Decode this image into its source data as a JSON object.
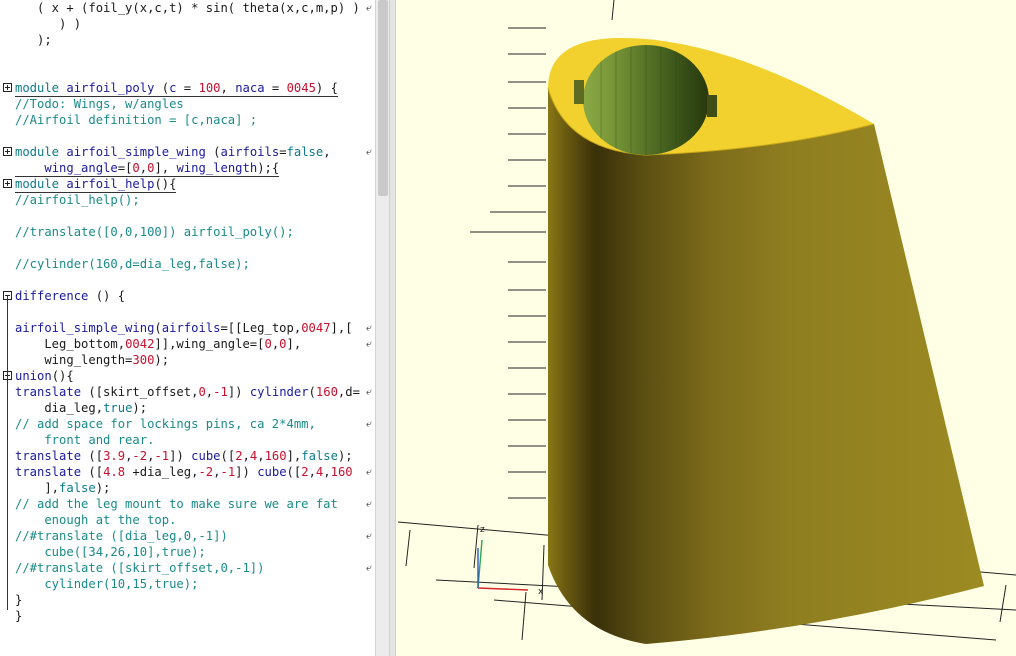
{
  "editor": {
    "lines": [
      {
        "t": 0,
        "gutter": "",
        "wrap": true,
        "tokens": [
          [
            "pl",
            "   ( x + (foil_y(x,c,t) * sin( theta(x,c,m,p) ) "
          ]
        ]
      },
      {
        "t": 16,
        "gutter": "",
        "tokens": [
          [
            "pl",
            "      ) )"
          ]
        ]
      },
      {
        "t": 32,
        "gutter": "",
        "tokens": [
          [
            "pl",
            "   );"
          ]
        ]
      },
      {
        "t": 48,
        "gutter": "",
        "tokens": [
          [
            "pl",
            ""
          ]
        ]
      },
      {
        "t": 64,
        "gutter": "",
        "tokens": [
          [
            "pl",
            ""
          ]
        ]
      },
      {
        "t": 80,
        "gutter": "plus",
        "underline": true,
        "tokens": [
          [
            "kw",
            "module"
          ],
          [
            "pl",
            " "
          ],
          [
            "id",
            "airfoil_poly"
          ],
          [
            "pl",
            " ("
          ],
          [
            "id",
            "c"
          ],
          [
            "pl",
            " = "
          ],
          [
            "num",
            "100"
          ],
          [
            "pl",
            ", "
          ],
          [
            "id",
            "naca"
          ],
          [
            "pl",
            " = "
          ],
          [
            "num",
            "0045"
          ],
          [
            "pl",
            ") {"
          ]
        ]
      },
      {
        "t": 96,
        "gutter": "",
        "tokens": [
          [
            "com",
            "//Todo: Wings, w/angles"
          ]
        ]
      },
      {
        "t": 112,
        "gutter": "",
        "tokens": [
          [
            "com",
            "//Airfoil definition = [c,naca] ;"
          ]
        ]
      },
      {
        "t": 128,
        "gutter": "",
        "tokens": [
          [
            "pl",
            ""
          ]
        ]
      },
      {
        "t": 144,
        "gutter": "plus",
        "wrap": true,
        "tokens": [
          [
            "kw",
            "module"
          ],
          [
            "pl",
            " "
          ],
          [
            "id",
            "airfoil_simple_wing"
          ],
          [
            "pl",
            " ("
          ],
          [
            "id",
            "airfoils"
          ],
          [
            "pl",
            "="
          ],
          [
            "kw",
            "false"
          ],
          [
            "pl",
            ","
          ]
        ]
      },
      {
        "t": 160,
        "gutter": "",
        "underline": true,
        "tokens": [
          [
            "pl",
            "    "
          ],
          [
            "id",
            "wing_angle"
          ],
          [
            "pl",
            "=["
          ],
          [
            "num",
            "0"
          ],
          [
            "pl",
            ","
          ],
          [
            "num",
            "0"
          ],
          [
            "pl",
            "], "
          ],
          [
            "id",
            "wing_length"
          ],
          [
            "pl",
            ");{"
          ]
        ]
      },
      {
        "t": 176,
        "gutter": "plus",
        "underline": true,
        "tokens": [
          [
            "kw",
            "module"
          ],
          [
            "pl",
            " "
          ],
          [
            "id",
            "airfoil_help"
          ],
          [
            "pl",
            "(){"
          ]
        ]
      },
      {
        "t": 192,
        "gutter": "",
        "tokens": [
          [
            "com",
            "//airfoil_help();"
          ]
        ]
      },
      {
        "t": 208,
        "gutter": "",
        "tokens": [
          [
            "pl",
            ""
          ]
        ]
      },
      {
        "t": 224,
        "gutter": "",
        "tokens": [
          [
            "com",
            "//translate([0,0,100]) airfoil_poly();"
          ]
        ]
      },
      {
        "t": 240,
        "gutter": "",
        "tokens": [
          [
            "pl",
            ""
          ]
        ]
      },
      {
        "t": 256,
        "gutter": "",
        "tokens": [
          [
            "com",
            "//cylinder(160,d=dia_leg,false);"
          ]
        ]
      },
      {
        "t": 272,
        "gutter": "",
        "tokens": [
          [
            "pl",
            ""
          ]
        ]
      },
      {
        "t": 288,
        "gutter": "minus",
        "tokens": [
          [
            "id",
            "difference"
          ],
          [
            "pl",
            " () {"
          ]
        ]
      },
      {
        "t": 304,
        "gutter": "",
        "tokens": [
          [
            "pl",
            ""
          ]
        ]
      },
      {
        "t": 320,
        "gutter": "",
        "wrap": true,
        "tokens": [
          [
            "id",
            "airfoil_simple_wing"
          ],
          [
            "pl",
            "("
          ],
          [
            "id",
            "airfoils"
          ],
          [
            "pl",
            "=[[Leg_top,"
          ],
          [
            "num",
            "0047"
          ],
          [
            "pl",
            "],["
          ]
        ]
      },
      {
        "t": 336,
        "gutter": "",
        "wrap": true,
        "tokens": [
          [
            "pl",
            "    Leg_bottom,"
          ],
          [
            "num",
            "0042"
          ],
          [
            "pl",
            "]],wing_angle=["
          ],
          [
            "num",
            "0"
          ],
          [
            "pl",
            ","
          ],
          [
            "num",
            "0"
          ],
          [
            "pl",
            "],"
          ]
        ]
      },
      {
        "t": 352,
        "gutter": "",
        "tokens": [
          [
            "pl",
            "    wing_length="
          ],
          [
            "num",
            "300"
          ],
          [
            "pl",
            ");"
          ]
        ]
      },
      {
        "t": 368,
        "gutter": "minus",
        "tokens": [
          [
            "id",
            "union"
          ],
          [
            "pl",
            "(){"
          ]
        ]
      },
      {
        "t": 384,
        "gutter": "",
        "wrap": true,
        "tokens": [
          [
            "id",
            "translate"
          ],
          [
            "pl",
            " ([skirt_offset,"
          ],
          [
            "num",
            "0"
          ],
          [
            "pl",
            ","
          ],
          [
            "num",
            "-1"
          ],
          [
            "pl",
            "]) "
          ],
          [
            "id",
            "cylinder"
          ],
          [
            "pl",
            "("
          ],
          [
            "num",
            "160"
          ],
          [
            "pl",
            ",d="
          ]
        ]
      },
      {
        "t": 400,
        "gutter": "",
        "tokens": [
          [
            "pl",
            "    dia_leg,"
          ],
          [
            "kw",
            "true"
          ],
          [
            "pl",
            ");"
          ]
        ]
      },
      {
        "t": 416,
        "gutter": "",
        "wrap": true,
        "tokens": [
          [
            "com",
            "// add space for lockings pins, ca 2*4mm,"
          ]
        ]
      },
      {
        "t": 432,
        "gutter": "",
        "tokens": [
          [
            "com",
            "    front and rear."
          ]
        ]
      },
      {
        "t": 448,
        "gutter": "",
        "tokens": [
          [
            "id",
            "translate"
          ],
          [
            "pl",
            " (["
          ],
          [
            "num",
            "3.9"
          ],
          [
            "pl",
            ","
          ],
          [
            "num",
            "-2"
          ],
          [
            "pl",
            ","
          ],
          [
            "num",
            "-1"
          ],
          [
            "pl",
            "]) "
          ],
          [
            "id",
            "cube"
          ],
          [
            "pl",
            "(["
          ],
          [
            "num",
            "2"
          ],
          [
            "pl",
            ","
          ],
          [
            "num",
            "4"
          ],
          [
            "pl",
            ","
          ],
          [
            "num",
            "160"
          ],
          [
            "pl",
            "],"
          ],
          [
            "kw",
            "false"
          ],
          [
            "pl",
            ");"
          ]
        ]
      },
      {
        "t": 464,
        "gutter": "",
        "wrap": true,
        "tokens": [
          [
            "id",
            "translate"
          ],
          [
            "pl",
            " (["
          ],
          [
            "num",
            "4.8"
          ],
          [
            "pl",
            " +dia_leg,"
          ],
          [
            "num",
            "-2"
          ],
          [
            "pl",
            ","
          ],
          [
            "num",
            "-1"
          ],
          [
            "pl",
            "]) "
          ],
          [
            "id",
            "cube"
          ],
          [
            "pl",
            "(["
          ],
          [
            "num",
            "2"
          ],
          [
            "pl",
            ","
          ],
          [
            "num",
            "4"
          ],
          [
            "pl",
            ","
          ],
          [
            "num",
            "160"
          ]
        ]
      },
      {
        "t": 480,
        "gutter": "",
        "tokens": [
          [
            "pl",
            "    ],"
          ],
          [
            "kw",
            "false"
          ],
          [
            "pl",
            ");"
          ]
        ]
      },
      {
        "t": 496,
        "gutter": "",
        "wrap": true,
        "tokens": [
          [
            "com",
            "// add the leg mount to make sure we are fat"
          ]
        ]
      },
      {
        "t": 512,
        "gutter": "",
        "tokens": [
          [
            "com",
            "    enough at the top."
          ]
        ]
      },
      {
        "t": 528,
        "gutter": "",
        "wrap": true,
        "tokens": [
          [
            "com",
            "//#translate ([dia_leg,0,-1])"
          ]
        ]
      },
      {
        "t": 544,
        "gutter": "",
        "tokens": [
          [
            "com",
            "    cube([34,26,10],true);"
          ]
        ]
      },
      {
        "t": 560,
        "gutter": "",
        "wrap": true,
        "tokens": [
          [
            "com",
            "//#translate ([skirt_offset,0,-1])"
          ]
        ]
      },
      {
        "t": 576,
        "gutter": "",
        "tokens": [
          [
            "com",
            "    cylinder(10,15,true);"
          ]
        ]
      },
      {
        "t": 592,
        "gutter": "",
        "tokens": [
          [
            "pl",
            "}"
          ]
        ]
      },
      {
        "t": 608,
        "gutter": "",
        "tokens": [
          [
            "pl",
            "}"
          ]
        ]
      }
    ]
  },
  "colors": {
    "keyword": "#0d7a8a",
    "identifier": "#1a1a9c",
    "number": "#c8102e",
    "comment": "#1a8a8a",
    "viewport_background": "#ffffe6",
    "model_top_face": "#f2d12e",
    "model_side_face": "#9a8520",
    "hole_color": "#5e7a2a"
  },
  "icons": {
    "fold_expanded": "minus-box-icon",
    "fold_collapsed": "plus-box-icon",
    "line_wrap": "wrap-arrow-icon"
  }
}
